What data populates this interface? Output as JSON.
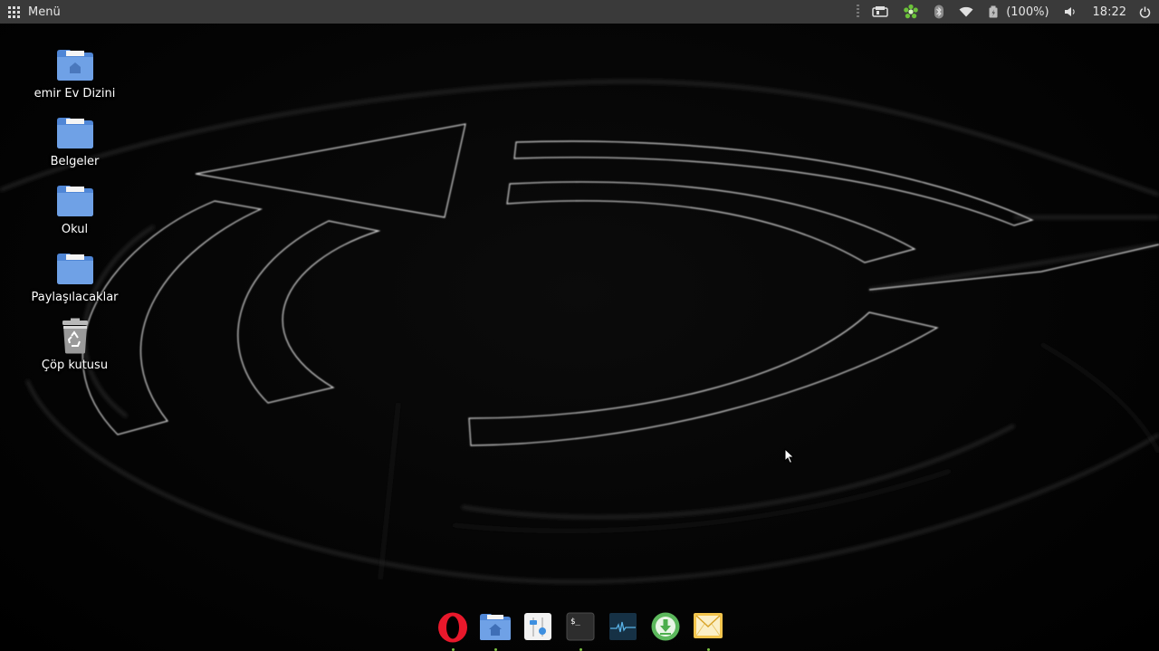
{
  "top_panel": {
    "menu_label": "Menü",
    "battery_percent": "(100%)",
    "clock": "18:22"
  },
  "tray_icons": [
    "drive-icon",
    "icq-flower-icon",
    "bluetooth-icon",
    "wifi-icon",
    "battery-icon",
    "volume-icon",
    "power-icon"
  ],
  "desktop_icons": [
    {
      "label": "emir Ev Dizini",
      "icon": "home-folder-icon"
    },
    {
      "label": "Belgeler",
      "icon": "folder-icon"
    },
    {
      "label": "Okul",
      "icon": "folder-icon"
    },
    {
      "label": "Paylaşılacaklar",
      "icon": "folder-icon"
    },
    {
      "label": "Çöp kutusu",
      "icon": "trash-icon"
    }
  ],
  "dock_items": [
    {
      "app": "opera",
      "icon": "opera-icon",
      "running": true
    },
    {
      "app": "files",
      "icon": "files-home-icon",
      "running": true
    },
    {
      "app": "settings",
      "icon": "settings-sliders-icon",
      "running": false
    },
    {
      "app": "terminal",
      "icon": "terminal-icon",
      "running": true,
      "prompt": "$_"
    },
    {
      "app": "system-monitor",
      "icon": "system-monitor-icon",
      "running": false
    },
    {
      "app": "downloader",
      "icon": "download-icon",
      "running": false
    },
    {
      "app": "mail",
      "icon": "mail-icon",
      "running": true
    }
  ],
  "colors": {
    "panel_bg": "#3a3a3a",
    "folder_blue": "#6fa1e6",
    "running_dot": "#7bc142"
  }
}
